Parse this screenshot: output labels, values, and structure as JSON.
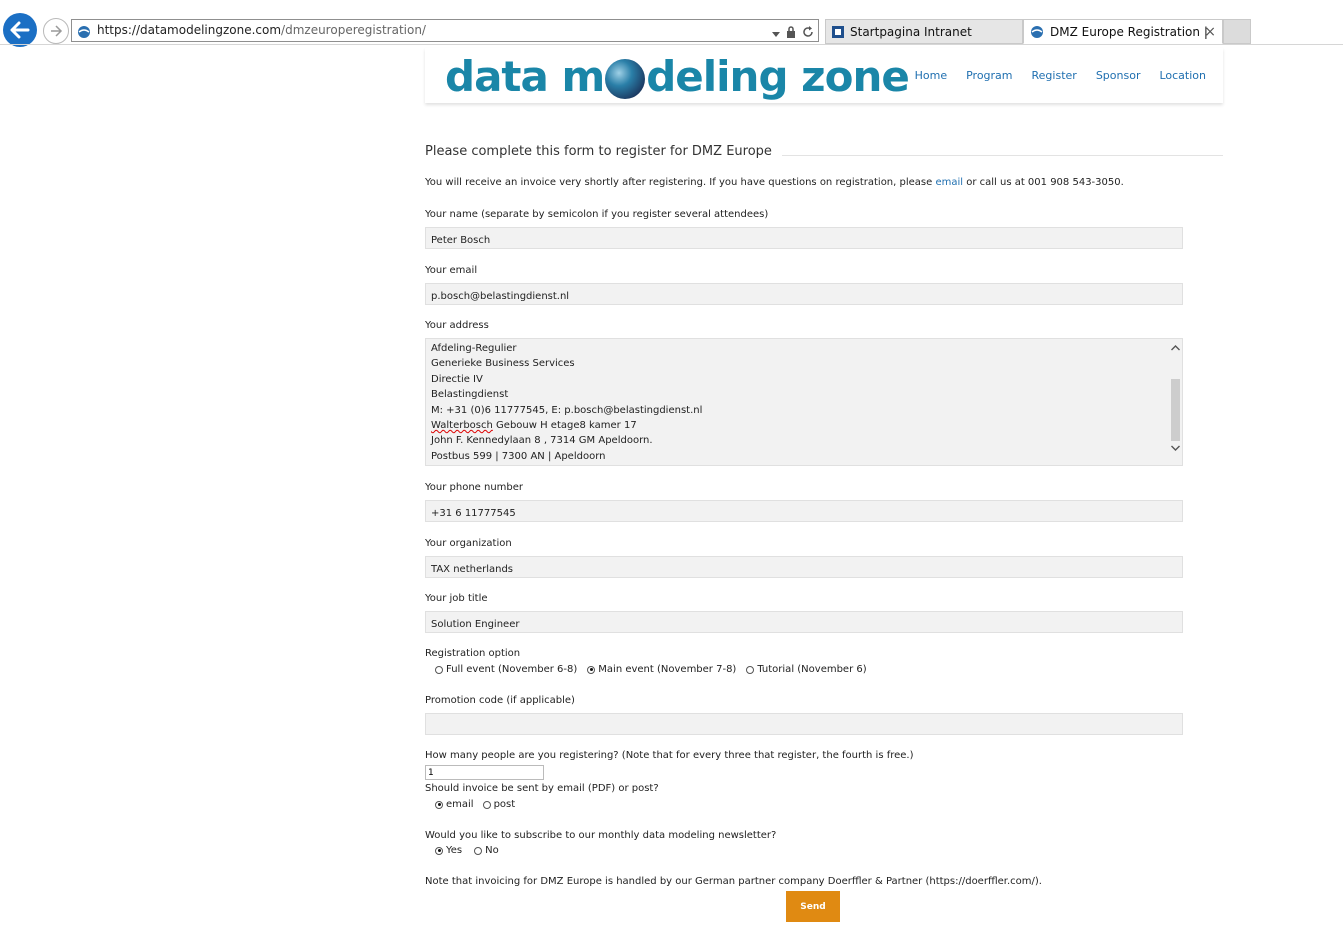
{
  "browser": {
    "url_domain": "https://datamodelingzone.com",
    "url_path": "/dmzeuroperegistration/",
    "tabs": [
      {
        "label": "Startpagina Intranet",
        "active": false
      },
      {
        "label": "DMZ Europe Registration |",
        "active": true
      }
    ],
    "tab_close": "×"
  },
  "site": {
    "logo_part1": "data m",
    "logo_part2": "deling zone",
    "nav": [
      "Home",
      "Program",
      "Register",
      "Sponsor",
      "Location"
    ]
  },
  "form": {
    "heading": "Please complete this form to register for DMZ Europe",
    "intro_before": "You will receive an invoice very shortly after registering. If you have questions on registration, please ",
    "intro_link": "email",
    "intro_after": " or call us at 001 908 543-3050.",
    "name_label": "Your name (separate by semicolon if you register several attendees)",
    "name_value": "Peter Bosch",
    "email_label": "Your email",
    "email_value": "p.bosch@belastingdienst.nl",
    "address_label": "Your address",
    "address_lines": [
      "Afdeling-Regulier",
      "Generieke Business Services",
      "Directie IV",
      "Belastingdienst",
      "M: +31 (0)6 11777545, E: p.bosch@belastingdienst.nl",
      "Walterbosch",
      " Gebouw H etage8 kamer 17",
      "John F.  Kennedylaan 8 ,  7314 GM Apeldoorn.",
      "Postbus 599 | 7300 AN | Apeldoorn"
    ],
    "phone_label": "Your phone number",
    "phone_value": "+31 6 11777545",
    "org_label": "Your organization",
    "org_value": "TAX netherlands",
    "job_label": "Your job title",
    "job_value": "Solution Engineer",
    "reg_label": "Registration option",
    "reg_options": [
      "Full event (November 6-8)",
      "Main event (November 7-8)",
      "Tutorial (November 6)"
    ],
    "reg_selected": 1,
    "promo_label": "Promotion code (if applicable)",
    "promo_value": "",
    "count_label": "How many people are you registering? (Note that for every three that register, the fourth is free.)",
    "count_value": "1",
    "invoice_label": "Should invoice be sent by email (PDF) or post?",
    "invoice_options": [
      "email",
      "post"
    ],
    "invoice_selected": 0,
    "newsletter_label": "Would you like to subscribe to our monthly data modeling newsletter?",
    "newsletter_options": [
      "Yes",
      "No"
    ],
    "newsletter_selected": 0,
    "note": "Note that invoicing for DMZ Europe is handled by our German partner company Doerffler & Partner (https://doerffler.com/).",
    "send_label": "Send"
  },
  "colors": {
    "accent": "#1f6fb0",
    "logo": "#1a86a8",
    "send": "#e08a12"
  }
}
